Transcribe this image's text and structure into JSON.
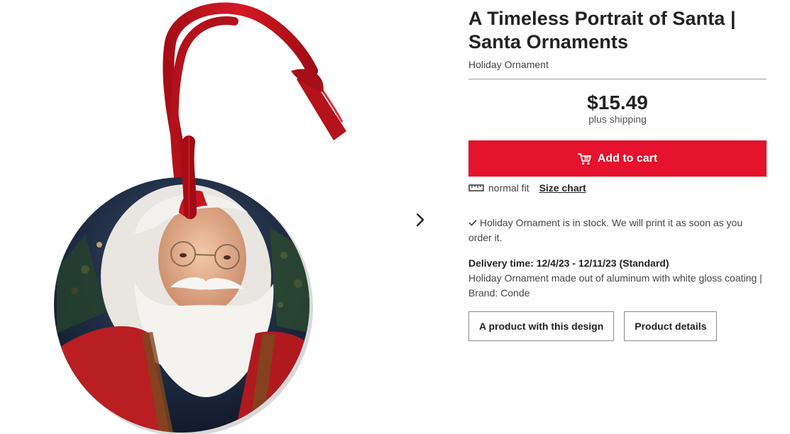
{
  "product": {
    "title_line1": "A Timeless Portrait of Santa |",
    "title_line2": "Santa Ornaments",
    "subtitle": "Holiday Ornament",
    "price": "$15.49",
    "shipping": "plus shipping"
  },
  "actions": {
    "add_to_cart": "Add to cart",
    "fit_text": "normal fit",
    "size_chart": "Size chart"
  },
  "stock": {
    "text": "Holiday Ornament is in stock. We will print it as soon as you order it."
  },
  "delivery": {
    "label": "Delivery time: 12/4/23 - 12/11/23 (Standard)",
    "description": "Holiday Ornament made out of aluminum with white gloss coating | Brand: Conde"
  },
  "buttons": {
    "design": "A product with this design",
    "details": "Product details"
  },
  "colors": {
    "accent": "#e4122c",
    "ribbon": "#c8141e"
  },
  "icons": {
    "next": "chevron-right-icon",
    "cart": "cart-icon",
    "ruler": "ruler-icon",
    "check": "check-icon"
  }
}
